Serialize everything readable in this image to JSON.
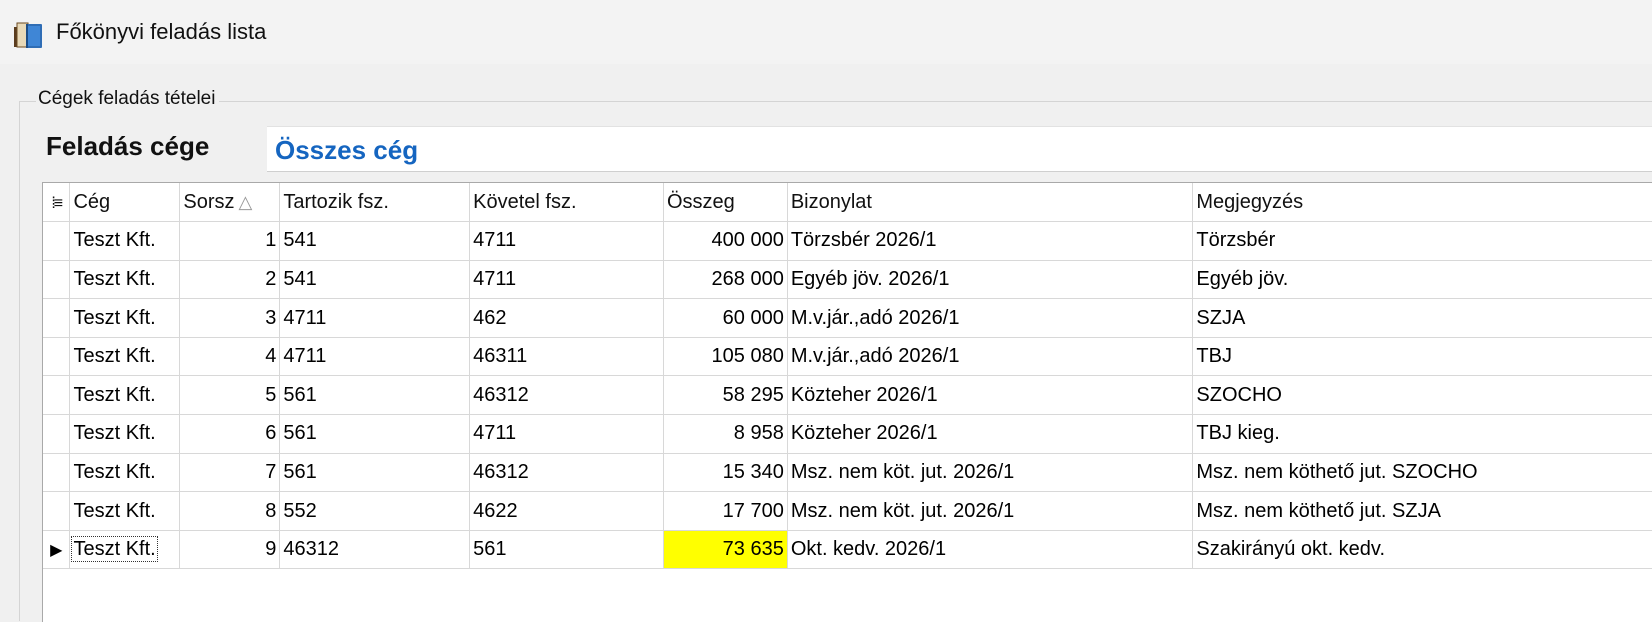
{
  "window": {
    "title": "Főkönyvi feladás lista",
    "icon": "ledger-book-icon"
  },
  "group": {
    "legend": "Cégek feladás tételei"
  },
  "company": {
    "label": "Feladás cége",
    "value": "Összes cég",
    "value_color": "#1565c0"
  },
  "grid": {
    "columns": [
      "Cég",
      "Sorsz",
      "Tartozik fsz.",
      "Követel fsz.",
      "Összeg",
      "Bizonylat",
      "Megjegyzés"
    ],
    "sort_indicator": "△",
    "rows": [
      {
        "ceg": "Teszt Kft.",
        "sorsz": "1",
        "tartozik": "541",
        "kovetel": "4711",
        "osszeg": "400 000",
        "bizonylat": "Törzsbér 2026/1",
        "megjegyzes": "Törzsbér"
      },
      {
        "ceg": "Teszt Kft.",
        "sorsz": "2",
        "tartozik": "541",
        "kovetel": "4711",
        "osszeg": "268 000",
        "bizonylat": "Egyéb jöv. 2026/1",
        "megjegyzes": "Egyéb jöv."
      },
      {
        "ceg": "Teszt Kft.",
        "sorsz": "3",
        "tartozik": "4711",
        "kovetel": "462",
        "osszeg": "60 000",
        "bizonylat": "M.v.jár.,adó 2026/1",
        "megjegyzes": "SZJA"
      },
      {
        "ceg": "Teszt Kft.",
        "sorsz": "4",
        "tartozik": "4711",
        "kovetel": "46311",
        "osszeg": "105 080",
        "bizonylat": "M.v.jár.,adó 2026/1",
        "megjegyzes": "TBJ"
      },
      {
        "ceg": "Teszt Kft.",
        "sorsz": "5",
        "tartozik": "561",
        "kovetel": "46312",
        "osszeg": "58 295",
        "bizonylat": "Közteher 2026/1",
        "megjegyzes": "SZOCHO"
      },
      {
        "ceg": "Teszt Kft.",
        "sorsz": "6",
        "tartozik": "561",
        "kovetel": "4711",
        "osszeg": "8 958",
        "bizonylat": "Közteher 2026/1",
        "megjegyzes": "TBJ kieg."
      },
      {
        "ceg": "Teszt Kft.",
        "sorsz": "7",
        "tartozik": "561",
        "kovetel": "46312",
        "osszeg": "15 340",
        "bizonylat": "Msz. nem köt. jut. 2026/1",
        "megjegyzes": "Msz. nem köthető jut. SZOCHO"
      },
      {
        "ceg": "Teszt Kft.",
        "sorsz": "8",
        "tartozik": "552",
        "kovetel": "4622",
        "osszeg": "17 700",
        "bizonylat": "Msz. nem köt. jut. 2026/1",
        "megjegyzes": "Msz. nem köthető jut. SZJA"
      },
      {
        "ceg": "Teszt Kft.",
        "sorsz": "9",
        "tartozik": "46312",
        "kovetel": "561",
        "osszeg": "73 635",
        "bizonylat": "Okt. kedv. 2026/1",
        "megjegyzes": "Szakirányú okt. kedv."
      }
    ],
    "current_row": 8,
    "highlight_color": "#ffff00"
  }
}
